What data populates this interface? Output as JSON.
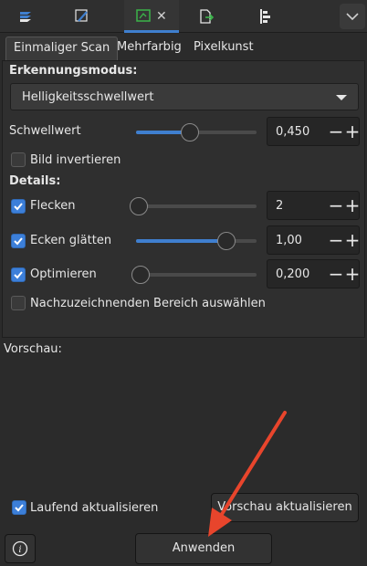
{
  "toolbar": {
    "icons": [
      "layers-icon",
      "pen-icon",
      "trace-bitmap-icon",
      "close-icon",
      "export-icon",
      "align-icon",
      "chevron-down-icon"
    ]
  },
  "tabs": [
    {
      "label": "Einmaliger Scan"
    },
    {
      "label": "Mehrfarbig"
    },
    {
      "label": "Pixelkunst"
    }
  ],
  "mode": {
    "label": "Erkennungsmodus:",
    "selected": "Helligkeitsschwellwert"
  },
  "threshold": {
    "label": "Schwellwert",
    "value": "0,450",
    "level": 0.45
  },
  "invert": {
    "label": "Bild invertieren",
    "checked": false
  },
  "details": {
    "label": "Details:",
    "speckles": {
      "label": "Flecken",
      "checked": true,
      "value": "2",
      "level": 0.02
    },
    "smooth": {
      "label": "Ecken glätten",
      "checked": true,
      "value": "1,00",
      "level": 0.75
    },
    "optimize": {
      "label": "Optimieren",
      "checked": true,
      "value": "0,200",
      "level": 0.04
    }
  },
  "select_area": {
    "label": "Nachzuzeichnenden Bereich auswählen",
    "checked": false
  },
  "preview": {
    "label": "Vorschau:",
    "live_update": {
      "label": "Laufend aktualisieren",
      "checked": true
    },
    "update_button": "Vorschau aktualisieren"
  },
  "apply_button": "Anwenden",
  "colors": {
    "accent": "#3f7fcf",
    "checkbox": "#3c7fd9",
    "annotation_arrow": "#e8452c"
  }
}
